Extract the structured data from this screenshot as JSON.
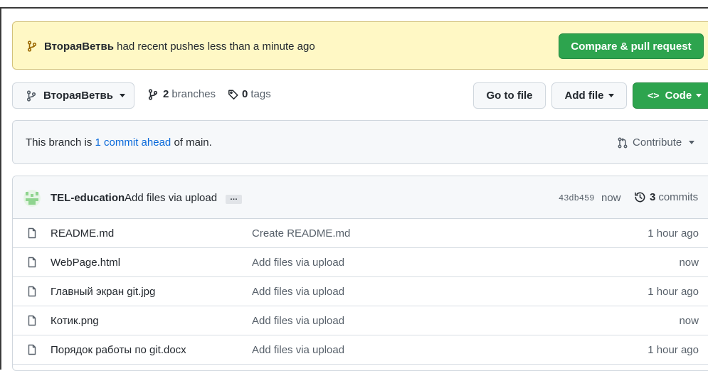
{
  "banner": {
    "branch": "ВтораяВетвь",
    "message": "had recent pushes less than a minute ago",
    "compare_label": "Compare & pull request"
  },
  "toolbar": {
    "branch_label": "ВтораяВетвь",
    "branches_count": "2",
    "branches_label": "branches",
    "tags_count": "0",
    "tags_label": "tags",
    "goto_file_label": "Go to file",
    "add_file_label": "Add file",
    "code_label": "Code",
    "code_glyph": "<>"
  },
  "ahead": {
    "prefix": "This branch is",
    "link": "1 commit ahead",
    "suffix": "of main.",
    "contribute_label": "Contribute"
  },
  "latest_commit": {
    "author": "TEL-education",
    "message": "Add files via upload",
    "ellipsis": "…",
    "hash": "43db459",
    "when": "now",
    "commits_count": "3",
    "commits_label": "commits"
  },
  "files": [
    {
      "name": "README.md",
      "message": "Create README.md",
      "age": "1 hour ago"
    },
    {
      "name": "WebPage.html",
      "message": "Add files via upload",
      "age": "now"
    },
    {
      "name": "Главный экран git.jpg",
      "message": "Add files via upload",
      "age": "1 hour ago"
    },
    {
      "name": "Котик.png",
      "message": "Add files via upload",
      "age": "now"
    },
    {
      "name": "Порядок работы по git.docx",
      "message": "Add files via upload",
      "age": "1 hour ago"
    }
  ],
  "colors": {
    "banner_bg": "#fff8c5",
    "primary_green": "#2da44e",
    "link_blue": "#0969da",
    "muted_text": "#57606a"
  }
}
